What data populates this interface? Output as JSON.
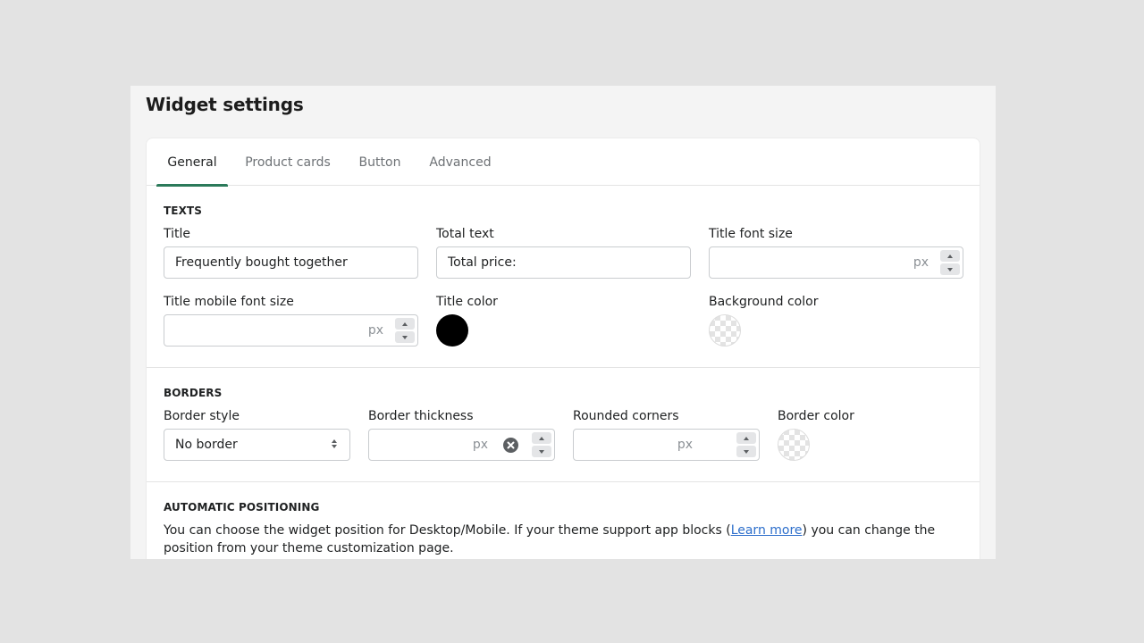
{
  "page": {
    "title": "Widget settings"
  },
  "tabs": [
    {
      "label": "General",
      "active": true
    },
    {
      "label": "Product cards",
      "active": false
    },
    {
      "label": "Button",
      "active": false
    },
    {
      "label": "Advanced",
      "active": false
    }
  ],
  "texts_section": {
    "heading": "TEXTS",
    "title": {
      "label": "Title",
      "value": "Frequently bought together"
    },
    "total_text": {
      "label": "Total text",
      "value": "Total price:"
    },
    "title_font_size": {
      "label": "Title font size",
      "value": "",
      "suffix": "px"
    },
    "title_mobile_font_size": {
      "label": "Title mobile font size",
      "value": "",
      "suffix": "px"
    },
    "title_color": {
      "label": "Title color",
      "color": "#000000"
    },
    "background_color": {
      "label": "Background color",
      "color": "transparent"
    }
  },
  "borders_section": {
    "heading": "BORDERS",
    "border_style": {
      "label": "Border style",
      "value": "No border"
    },
    "border_thickness": {
      "label": "Border thickness",
      "value": "",
      "suffix": "px"
    },
    "rounded_corners": {
      "label": "Rounded corners",
      "value": "",
      "suffix": "px"
    },
    "border_color": {
      "label": "Border color",
      "color": "transparent"
    }
  },
  "positioning_section": {
    "heading": "AUTOMATIC POSITIONING",
    "text_before": "You can choose the widget position for Desktop/Mobile. If your theme support app blocks (",
    "link_text": "Learn more",
    "text_after": ") you can change the position from your theme customization page."
  },
  "colors": {
    "accent": "#2b7a5a",
    "link": "#2c6ecb"
  }
}
